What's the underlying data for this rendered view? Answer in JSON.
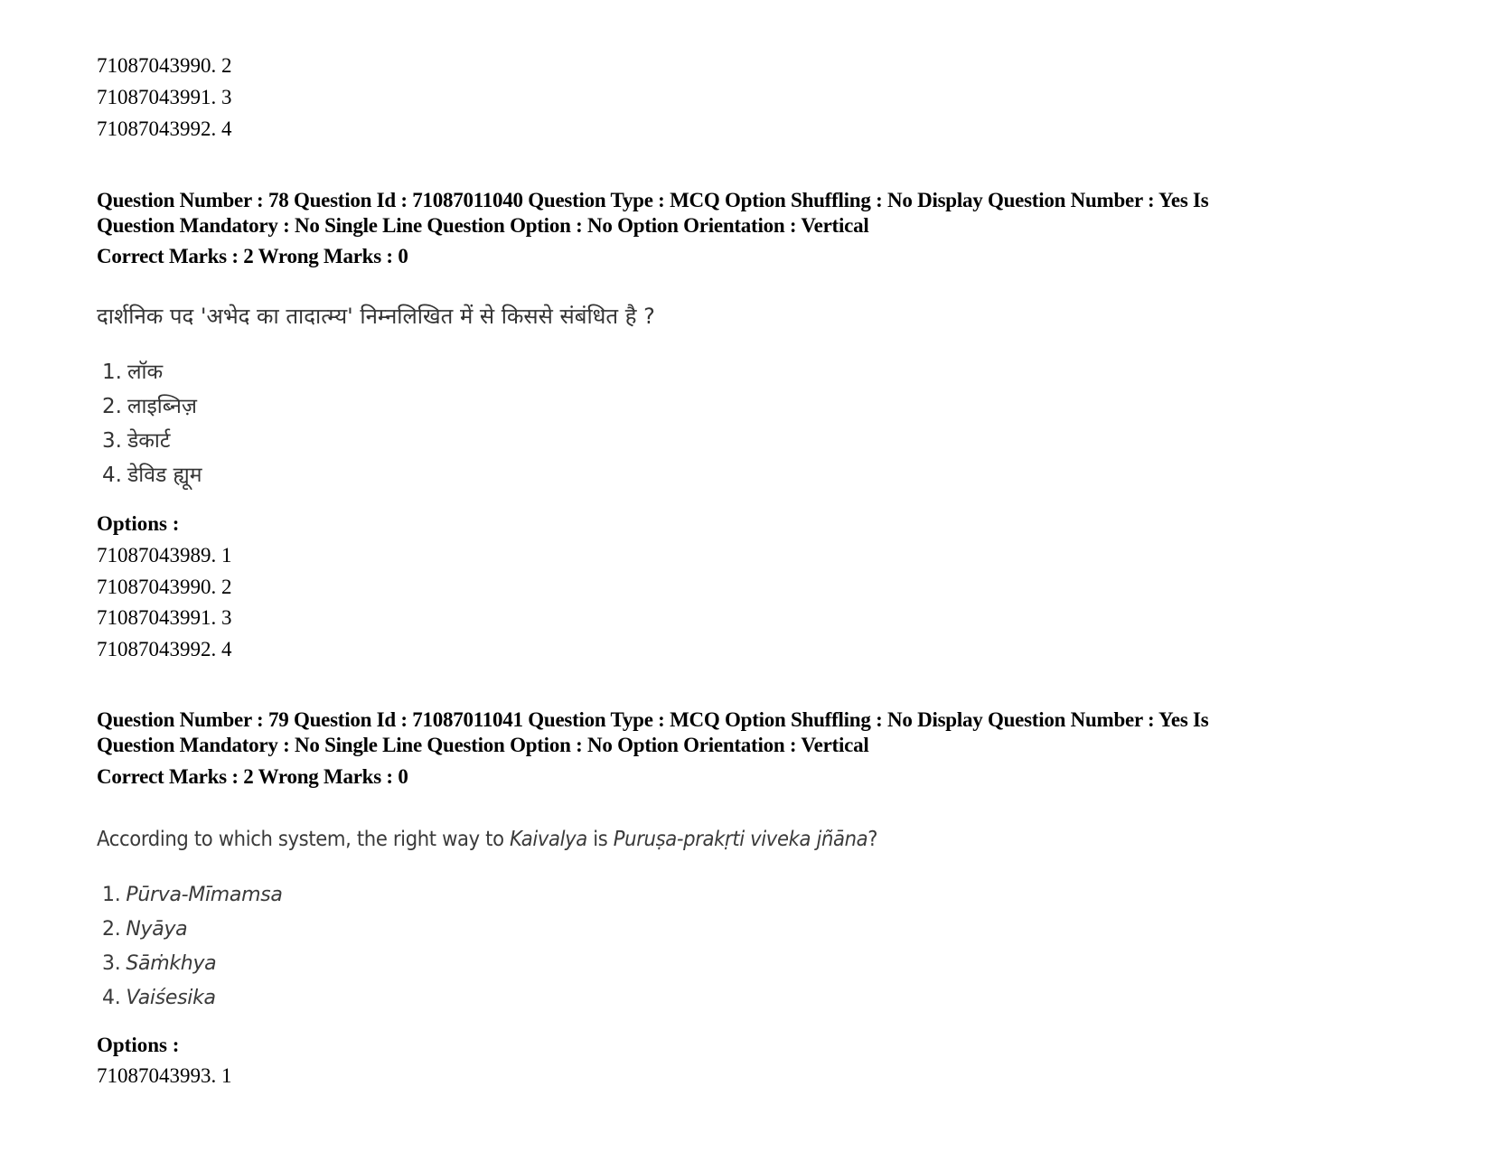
{
  "carryover_options": [
    {
      "id": "71087043990",
      "value": "2"
    },
    {
      "id": "71087043991",
      "value": "3"
    },
    {
      "id": "71087043992",
      "value": "4"
    }
  ],
  "questions": [
    {
      "meta_line1": "Question Number : 78 Question Id : 71087011040 Question Type : MCQ Option Shuffling : No Display Question Number : Yes Is",
      "meta_line2": "Question Mandatory : No Single Line Question Option : No Option Orientation : Vertical",
      "marks_line": "Correct Marks : 2 Wrong Marks : 0",
      "question_text": "दार्शनिक पद 'अभेद का तादात्म्य' निम्नलिखित में से किससे संबंधित है ?",
      "choices": [
        {
          "num": "1.",
          "text": "लॉक"
        },
        {
          "num": "2.",
          "text": "लाइब्निज़"
        },
        {
          "num": "3.",
          "text": "डेकार्ट"
        },
        {
          "num": "4.",
          "text": "डेविड ह्यूम"
        }
      ],
      "options_label": "Options :",
      "options": [
        {
          "id": "71087043989",
          "value": "1"
        },
        {
          "id": "71087043990",
          "value": "2"
        },
        {
          "id": "71087043991",
          "value": "3"
        },
        {
          "id": "71087043992",
          "value": "4"
        }
      ]
    },
    {
      "meta_line1": "Question Number : 79 Question Id : 71087011041 Question Type : MCQ Option Shuffling : No Display Question Number : Yes Is",
      "meta_line2": "Question Mandatory : No Single Line Question Option : No Option Orientation : Vertical",
      "marks_line": "Correct Marks : 2 Wrong Marks : 0",
      "question_parts": {
        "p1": "According to which system, the right way to ",
        "p2": "Kaivalya",
        "p3": " is ",
        "p4": "Puruṣa-prakṛti viveka jñāna",
        "p5": "?"
      },
      "choices": [
        {
          "num": "1.",
          "text": "Pūrva-Mīmamsa"
        },
        {
          "num": "2.",
          "text": "Nyāya"
        },
        {
          "num": "3.",
          "text": "Sāṁkhya"
        },
        {
          "num": "4.",
          "text": "Vaiśesika"
        }
      ],
      "options_label": "Options :",
      "options": [
        {
          "id": "71087043993",
          "value": "1"
        }
      ]
    }
  ]
}
